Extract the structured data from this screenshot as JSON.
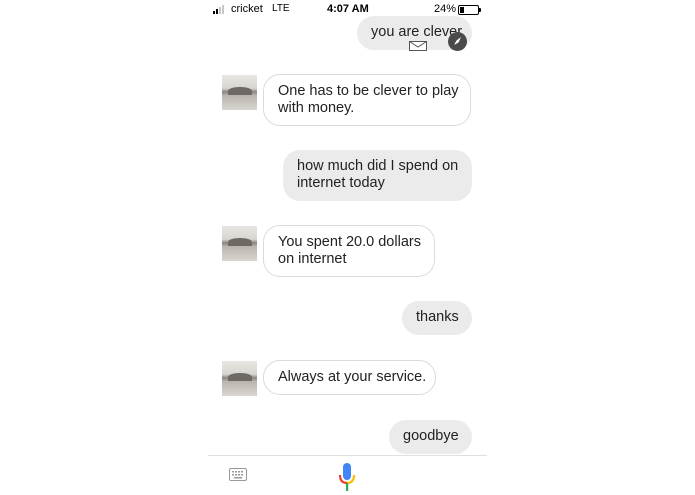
{
  "status_bar": {
    "carrier": "cricket",
    "network": "LTE",
    "time": "4:07 AM",
    "battery": "24%",
    "battery_level": 0.24,
    "signal_bars_filled": 2,
    "signal_bars_total": 4
  },
  "messages": [
    {
      "sender": "user",
      "text": "you are clever"
    },
    {
      "sender": "bot",
      "lines": [
        "One has to be clever to play",
        "with money."
      ]
    },
    {
      "sender": "user",
      "lines": [
        "how much did I spend on",
        "internet today"
      ]
    },
    {
      "sender": "bot",
      "lines": [
        "You spent 20.0 dollars",
        "on internet"
      ]
    },
    {
      "sender": "user",
      "text": "thanks"
    },
    {
      "sender": "bot",
      "text": "Always at your service."
    },
    {
      "sender": "user",
      "text": "goodbye"
    }
  ],
  "icons": {
    "overlay": "compass-icon",
    "mail": "mail-icon",
    "keyboard": "keyboard-icon",
    "mic": "microphone-icon"
  },
  "colors": {
    "user_bubble": "#ebebeb",
    "bot_bubble_border": "#dadada",
    "mic_blue": "#4285f4",
    "mic_red": "#ea4335",
    "mic_yellow": "#fbbc05",
    "mic_green": "#34a853"
  }
}
